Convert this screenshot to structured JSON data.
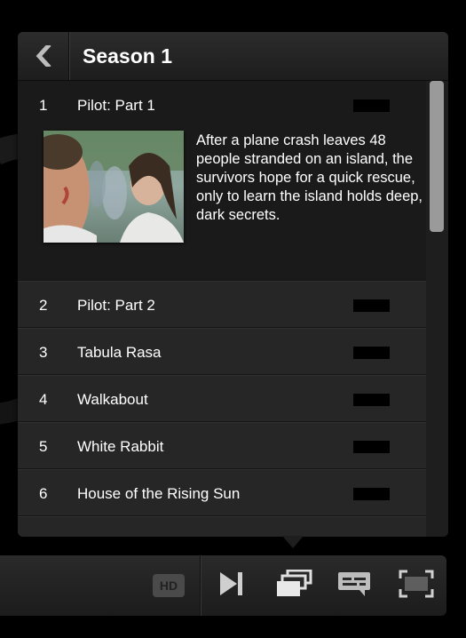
{
  "panel": {
    "title": "Season 1",
    "back_icon": "chevron-left-icon"
  },
  "episodes": [
    {
      "number": "1",
      "title": "Pilot: Part 1",
      "description": "After a plane crash leaves 48 people stranded on an island, the survivors hope for a quick rescue, only to learn the island holds deep, dark secrets."
    },
    {
      "number": "2",
      "title": "Pilot: Part 2"
    },
    {
      "number": "3",
      "title": "Tabula Rasa"
    },
    {
      "number": "4",
      "title": "Walkabout"
    },
    {
      "number": "5",
      "title": "White Rabbit"
    },
    {
      "number": "6",
      "title": "House of the Rising Sun"
    }
  ],
  "controls": {
    "hd_label": "HD",
    "icons": [
      "hd-icon",
      "next-episode-icon",
      "episodes-icon",
      "subtitles-icon",
      "fullscreen-icon"
    ]
  },
  "colors": {
    "panel_bg": "#1e1e1e",
    "row_bg": "#262626",
    "scroll_thumb": "#9a9a9a"
  }
}
